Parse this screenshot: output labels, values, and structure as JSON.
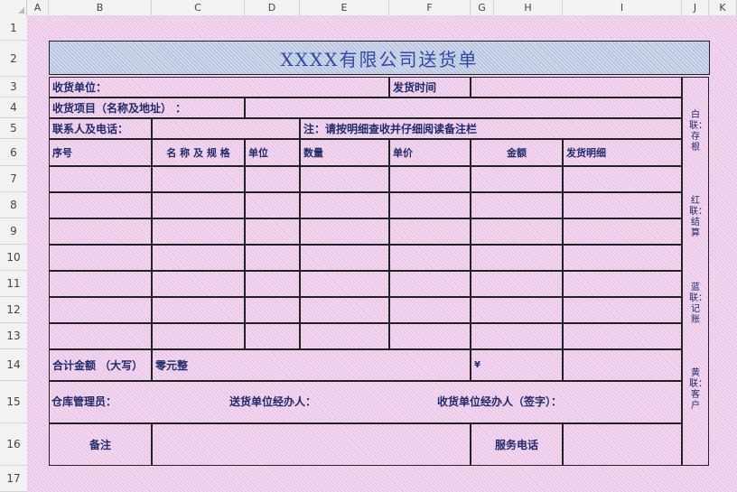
{
  "sheet": {
    "columns": [
      "A",
      "B",
      "C",
      "D",
      "E",
      "F",
      "G",
      "H",
      "I",
      "J",
      "K"
    ],
    "rows": [
      "1",
      "2",
      "3",
      "4",
      "5",
      "6",
      "7",
      "8",
      "9",
      "10",
      "11",
      "12",
      "13",
      "14",
      "15",
      "16",
      "17"
    ]
  },
  "form": {
    "title": "XXXX有限公司送货单",
    "receiver_label": "收货单位：",
    "ship_time_label": "发货时间",
    "project_label": "收货项目（名称及地址）  ：",
    "contact_label": "联系人及电话：",
    "note_text": "注：请按明细查收并仔细阅读备注栏",
    "headers": {
      "seq": "序号",
      "name": "名 称 及 规 格",
      "unit": "单位",
      "qty": "数量",
      "price": "单价",
      "amount": "金额",
      "detail": "发货明细"
    },
    "total_label": "合计金额 （大写）",
    "total_value": "零元整",
    "total_symbol": "¥",
    "warehouse_label": "仓库管理员：",
    "sender_label": "送货单位经办人：",
    "receiver_sign_label": "收货单位经办人（签字）：",
    "remark_label": "备注",
    "service_phone_label": "服务电话",
    "side_copies": [
      "白联：存根",
      "红联：结算",
      "蓝联：记账",
      "黄联：客户"
    ]
  }
}
